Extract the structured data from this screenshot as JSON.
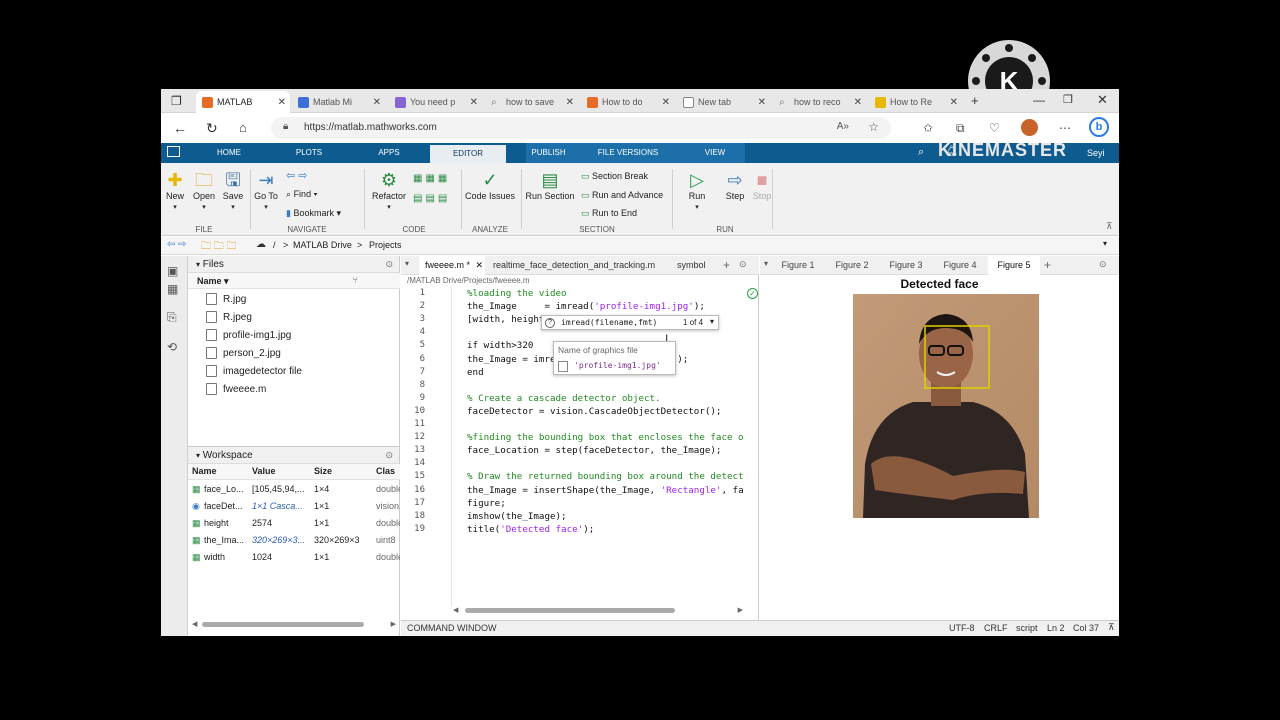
{
  "browser": {
    "tabs": [
      {
        "label": "MATLAB",
        "active": true,
        "favicon_color": "#e76b27"
      },
      {
        "label": "Matlab Mi",
        "favicon_color": "#3b6fd8"
      },
      {
        "label": "You need p",
        "favicon_color": "#8a63d2"
      },
      {
        "label": "how to save",
        "favicon_color": "#888888"
      },
      {
        "label": "How to do",
        "favicon_color": "#e76b27"
      },
      {
        "label": "New tab",
        "favicon_color": "#888888"
      },
      {
        "label": "how to reco",
        "favicon_color": "#888888"
      },
      {
        "label": "How to Re",
        "favicon_color": "#e8b800"
      }
    ],
    "new_tab": "+",
    "url": "https://matlab.mathworks.com",
    "profile_label": "Seyi"
  },
  "matlab_tabs": [
    "HOME",
    "PLOTS",
    "APPS",
    "EDITOR",
    "PUBLISH",
    "FILE VERSIONS",
    "VIEW"
  ],
  "active_matlab_tab": "EDITOR",
  "ribbon": {
    "new": "New",
    "open": "Open",
    "save": "Save",
    "file_section": "FILE",
    "goto": "Go To",
    "find": "Find",
    "bookmark": "Bookmark",
    "navigate_section": "NAVIGATE",
    "refactor": "Refactor",
    "code_section": "CODE",
    "code_issues": "Code Issues",
    "analyze_section": "ANALYZE",
    "run_section": "Run Section",
    "section_break": "Section Break",
    "run_and_advance": "Run and Advance",
    "run_to_end": "Run to End",
    "section_section": "SECTION",
    "run": "Run",
    "step": "Step",
    "stop": "Stop",
    "run_group": "RUN"
  },
  "path": {
    "sep1": "/",
    "drive": "MATLAB Drive",
    "sep2": ">",
    "projects": "Projects"
  },
  "files": {
    "title": "Files",
    "name_col": "Name",
    "items": [
      "R.jpg",
      "R.jpeg",
      "profile-img1.jpg",
      "person_2.jpg",
      "imagedetector file",
      "fweeee.m"
    ]
  },
  "workspace": {
    "title": "Workspace",
    "cols": [
      "Name",
      "Value",
      "Size",
      "Clas"
    ],
    "rows": [
      {
        "name": "face_Lo...",
        "value": "[105,45,94,...",
        "size": "1×4",
        "cls": "double"
      },
      {
        "name": "faceDet...",
        "value": "1×1 Casca...",
        "size": "1×1",
        "cls": "vision."
      },
      {
        "name": "height",
        "value": "2574",
        "size": "1×1",
        "cls": "double"
      },
      {
        "name": "the_Ima...",
        "value": "320×269×3...",
        "size": "320×269×3",
        "cls": "uint8"
      },
      {
        "name": "width",
        "value": "1024",
        "size": "1×1",
        "cls": "double"
      }
    ]
  },
  "editor": {
    "tabs": [
      "fweeee.m *",
      "realtime_face_detection_and_tracking.m",
      "symbol"
    ],
    "path": "/MATLAB Drive/Projects/fweeee.m",
    "lines": [
      {
        "n": "1",
        "code": "%loading the video",
        "type": "comment"
      },
      {
        "n": "2",
        "pre": "the_Image     = imread(",
        "str": "'profile-img1.jpg'",
        "post": ");"
      },
      {
        "n": "3",
        "code": "[width, height"
      },
      {
        "n": "4",
        "code": ""
      },
      {
        "n": "5",
        "code": "if width>320"
      },
      {
        "n": "6",
        "code": "the_Image = imre                    N]);"
      },
      {
        "n": "7",
        "code": "end"
      },
      {
        "n": "8",
        "code": ""
      },
      {
        "n": "9",
        "code": "% Create a cascade detector object.",
        "type": "comment"
      },
      {
        "n": "10",
        "code": "faceDetector = vision.CascadeObjectDetector();"
      },
      {
        "n": "11",
        "code": ""
      },
      {
        "n": "12",
        "code": "%finding the bounding box that encloses the face o",
        "type": "comment"
      },
      {
        "n": "13",
        "code": "face_Location = step(faceDetector, the_Image);"
      },
      {
        "n": "14",
        "code": ""
      },
      {
        "n": "15",
        "code": "% Draw the returned bounding box around the detect",
        "type": "comment"
      },
      {
        "n": "16",
        "pre": "the_Image = insertShape(the_Image, ",
        "str": "'Rectangle'",
        "post": ", fa"
      },
      {
        "n": "17",
        "code": "figure;"
      },
      {
        "n": "18",
        "code": "imshow(the_Image);"
      },
      {
        "n": "19",
        "pre": "title(",
        "str": "'Detected face'",
        "post": ");"
      }
    ],
    "hint": {
      "sig": "imread(filename,fmt)",
      "count": "1 of 4",
      "param_desc": "Name of graphics file",
      "suggestion": "'profile-img1.jpg'"
    }
  },
  "figures": {
    "tabs": [
      "Figure 1",
      "Figure 2",
      "Figure 3",
      "Figure 4",
      "Figure 5"
    ],
    "active": "Figure 5",
    "title": "Detected face"
  },
  "status": {
    "command_window": "COMMAND WINDOW",
    "encoding": "UTF-8",
    "eol": "CRLF",
    "type": "script",
    "ln": "Ln 2",
    "col": "Col 37"
  },
  "watermark": "KINEMASTER"
}
